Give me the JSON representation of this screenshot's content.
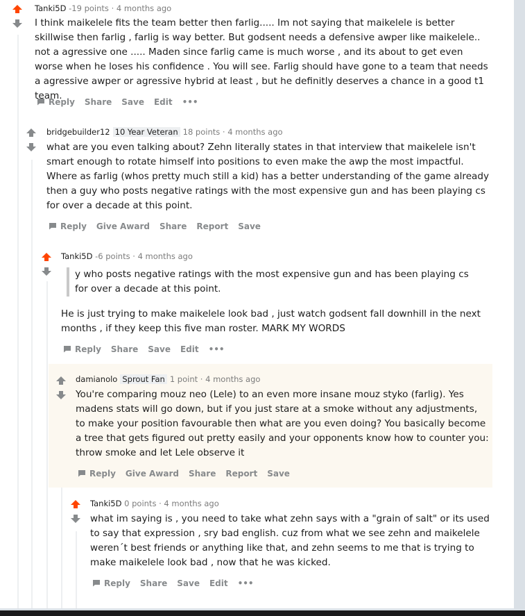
{
  "colors": {
    "upvote": "#ff4500",
    "neutral": "#878a8c",
    "highlight_bg": "#fcf8f0"
  },
  "comments": [
    {
      "author": "Tanki5D",
      "flair": "",
      "points": "-19 points",
      "time": "4 months ago",
      "upvoted": true,
      "body": "I think maikelele fits the team better then farlig..... Im not saying that maikelele is better skillwise then farlig , farlig is way better. But godsent needs a defensive awper like maikelele.. not a agressive one ..... Maden since farlig came is much worse , and its about to get even worse when he loses his confidence . You will see. Farlig should have gone to a team that needs a agressive awper or agressive hybrid at least , but he definitly deserves a chance in a good t1 team.",
      "actions": [
        "Reply",
        "Share",
        "Save",
        "Edit",
        "•••"
      ]
    },
    {
      "author": "bridgebuilder12",
      "flair": "10 Year Veteran",
      "points": "18 points",
      "time": "4 months ago",
      "upvoted": false,
      "body": "what are you even talking about? Zehn literally states in that interview that maikelele isn't smart enough to rotate himself into positions to even make the awp the most impactful. Where as farlig (whos pretty much still a kid) has a better understanding of the game already then a guy who posts negative ratings with the most expensive gun and has been playing cs for over a decade at this point.",
      "actions": [
        "Reply",
        "Give Award",
        "Share",
        "Report",
        "Save"
      ]
    },
    {
      "author": "Tanki5D",
      "flair": "",
      "points": "-6 points",
      "time": "4 months ago",
      "upvoted": true,
      "quote": "y who posts negative ratings with the most expensive gun and has been playing cs for over a decade at this point.",
      "body": "He is just trying to make maikelele look bad , just watch godsent fall downhill in the next months , if they keep this five man roster. MARK MY WORDS",
      "actions": [
        "Reply",
        "Share",
        "Save",
        "Edit",
        "•••"
      ]
    },
    {
      "author": "damianolo",
      "flair": "Sprout Fan",
      "points": "1 point",
      "time": "4 months ago",
      "upvoted": false,
      "body": "You're comparing mouz neo (Lele) to an even more insane mouz styko (farlig). Yes madens stats will go down, but if you just stare at a smoke without any adjustments, to make your position favourable then what are you even doing? You basically become a tree that gets figured out pretty easily and your opponents know how to counter you: throw smoke and let Lele observe it",
      "actions": [
        "Reply",
        "Give Award",
        "Share",
        "Report",
        "Save"
      ]
    },
    {
      "author": "Tanki5D",
      "flair": "",
      "points": "0 points",
      "time": "4 months ago",
      "upvoted": true,
      "body": "what im saying is , you need to take what zehn says with a \"grain of salt\" or its used to say that expression , sry bad english. cuz from what we see zehn and maikelele weren´t best friends or anything like that, and zehn seems to me that is trying to make maikelele look bad , now that he was kicked.",
      "actions": [
        "Reply",
        "Share",
        "Save",
        "Edit",
        "•••"
      ]
    }
  ]
}
